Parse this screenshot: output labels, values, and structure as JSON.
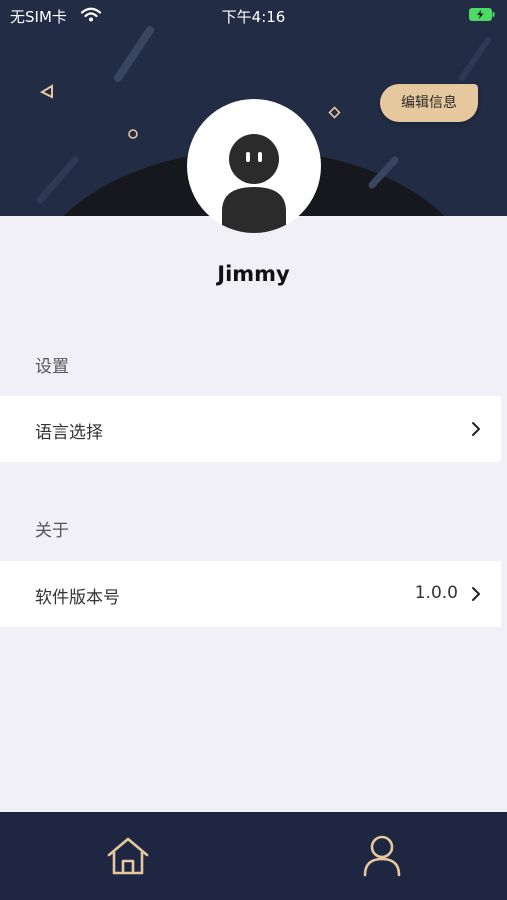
{
  "status_bar": {
    "carrier": "无SIM卡",
    "time": "下午4:16"
  },
  "header": {
    "edit_button_label": "编辑信息"
  },
  "profile": {
    "username": "Jimmy"
  },
  "sections": [
    {
      "title": "设置",
      "rows": [
        {
          "label": "语言选择",
          "value": ""
        }
      ]
    },
    {
      "title": "关于",
      "rows": [
        {
          "label": "软件版本号",
          "value": "1.0.0"
        }
      ]
    }
  ],
  "tabbar": {
    "items": [
      {
        "icon": "home-icon"
      },
      {
        "icon": "user-icon"
      }
    ]
  },
  "colors": {
    "header_bg": "#232c45",
    "accent": "#e6c89e",
    "page_bg": "#f1f0f6",
    "tabbar_bg": "#1e2641",
    "battery": "#4cd964"
  }
}
